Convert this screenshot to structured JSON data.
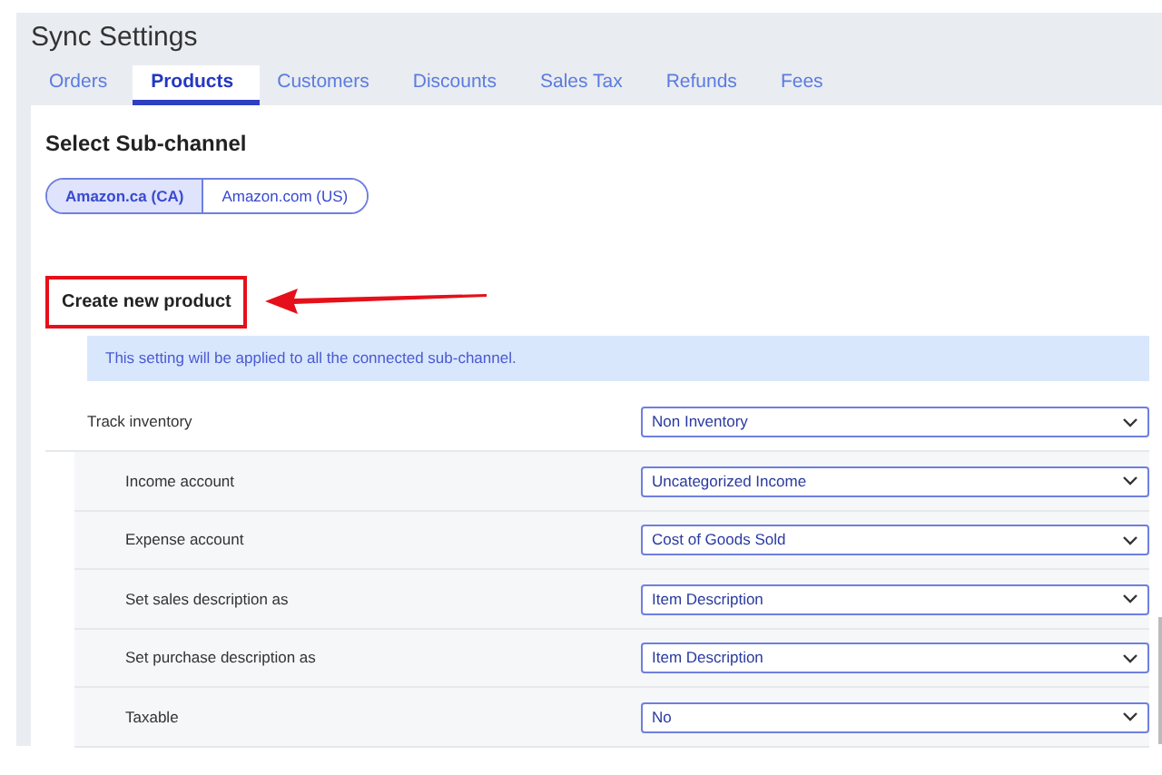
{
  "title": "Sync Settings",
  "tabs": [
    {
      "label": "Orders",
      "selected": false
    },
    {
      "label": "Products",
      "selected": true
    },
    {
      "label": "Customers",
      "selected": false
    },
    {
      "label": "Discounts",
      "selected": false
    },
    {
      "label": "Sales Tax",
      "selected": false
    },
    {
      "label": "Refunds",
      "selected": false
    },
    {
      "label": "Fees",
      "selected": false
    }
  ],
  "subchannel": {
    "heading": "Select Sub-channel",
    "options": [
      {
        "label": "Amazon.ca (CA)",
        "selected": true
      },
      {
        "label": "Amazon.com (US)",
        "selected": false
      }
    ]
  },
  "section": {
    "title": "Create new product",
    "highlighted": true,
    "notice": "This setting will be applied to all the connected sub-channel.",
    "rows": [
      {
        "kind": "main",
        "label": "Track inventory",
        "value": "Non Inventory"
      },
      {
        "kind": "sub",
        "label": "Income account",
        "value": "Uncategorized Income"
      },
      {
        "kind": "sub",
        "label": "Expense account",
        "value": "Cost of Goods Sold"
      },
      {
        "kind": "sub",
        "label": "Set sales description as",
        "value": "Item Description"
      },
      {
        "kind": "sub",
        "label": "Set purchase description as",
        "value": "Item Description"
      },
      {
        "kind": "sub",
        "label": "Taxable",
        "value": "No"
      }
    ]
  }
}
